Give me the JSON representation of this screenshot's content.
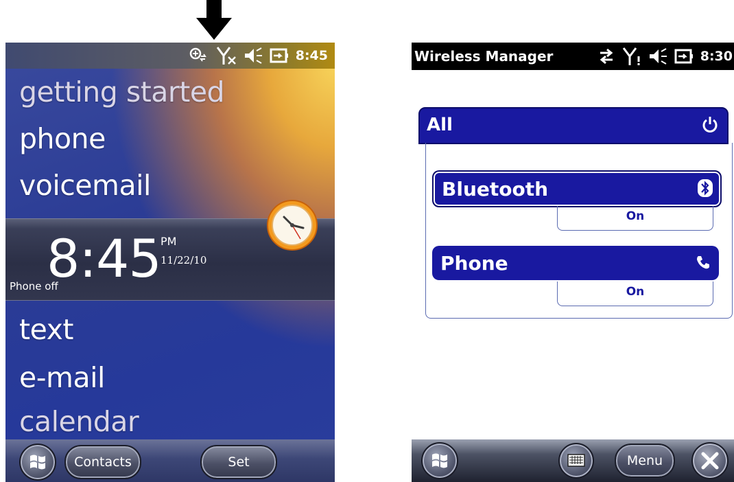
{
  "left_phone": {
    "status": {
      "time": "8:45",
      "icons": [
        "roaming-icon",
        "no-signal-icon",
        "volume-muted-icon",
        "battery-charging-icon"
      ]
    },
    "menu": [
      "getting started",
      "phone",
      "voicemail",
      "text",
      "e-mail",
      "calendar"
    ],
    "clock": {
      "time": "8:45",
      "ampm": "PM",
      "date": "11/22/10",
      "phone_status": "Phone off"
    },
    "softkeys": {
      "contacts": "Contacts",
      "set": "Set"
    }
  },
  "right_phone": {
    "title": "Wireless Manager",
    "status": {
      "time": "8:30",
      "icons": [
        "data-arrows-icon",
        "signal-alert-icon",
        "volume-muted-icon",
        "battery-charging-icon"
      ]
    },
    "all_label": "All",
    "radios": [
      {
        "name": "Bluetooth",
        "state": "On",
        "icon": "bluetooth-icon"
      },
      {
        "name": "Phone",
        "state": "On",
        "icon": "phone-handset-icon"
      }
    ],
    "softkeys": {
      "menu": "Menu"
    }
  },
  "colors": {
    "accent_blue": "#1919a0",
    "status_gold": "#b08a12"
  }
}
